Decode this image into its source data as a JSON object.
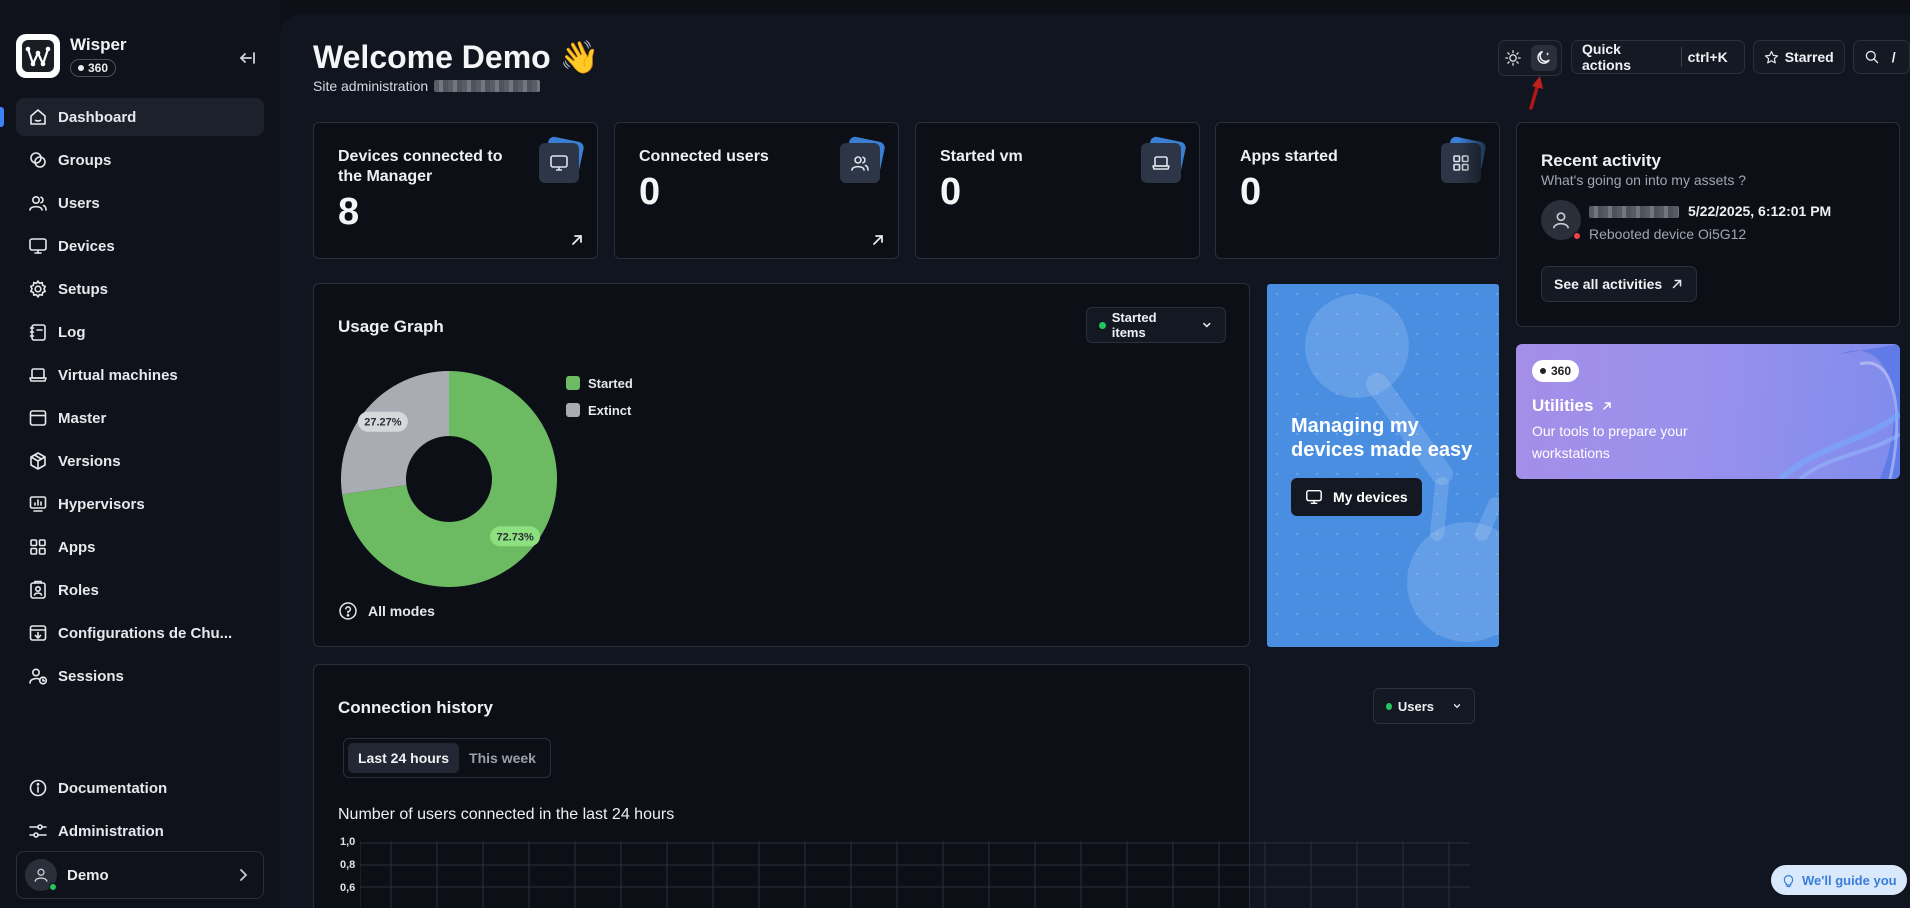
{
  "app": {
    "name": "Wisper",
    "badge": "360"
  },
  "sidebar": {
    "items": [
      {
        "label": "Dashboard",
        "icon": "home-icon"
      },
      {
        "label": "Groups",
        "icon": "groups-icon"
      },
      {
        "label": "Users",
        "icon": "users-icon"
      },
      {
        "label": "Devices",
        "icon": "monitor-icon"
      },
      {
        "label": "Setups",
        "icon": "gear-icon"
      },
      {
        "label": "Log",
        "icon": "log-icon"
      },
      {
        "label": "Virtual machines",
        "icon": "laptop-icon"
      },
      {
        "label": "Master",
        "icon": "window-icon"
      },
      {
        "label": "Versions",
        "icon": "package-icon"
      },
      {
        "label": "Hypervisors",
        "icon": "hypervisor-icon"
      },
      {
        "label": "Apps",
        "icon": "grid-icon"
      },
      {
        "label": "Roles",
        "icon": "roles-icon"
      },
      {
        "label": "Configurations de Chu...",
        "icon": "download-box-icon"
      },
      {
        "label": "Sessions",
        "icon": "user-clock-icon"
      }
    ],
    "bottom": [
      {
        "label": "Documentation",
        "icon": "info-icon"
      },
      {
        "label": "Administration",
        "icon": "sliders-icon"
      }
    ],
    "user": {
      "name": "Demo"
    }
  },
  "header": {
    "title": "Welcome Demo 👋",
    "subtitle": "Site administration",
    "quick_actions": "Quick actions",
    "quick_actions_shortcut": "ctrl+K",
    "starred": "Starred",
    "search_shortcut": "/"
  },
  "stats": [
    {
      "title": "Devices connected to the Manager",
      "value": "8",
      "icon": "monitor-icon"
    },
    {
      "title": "Connected users",
      "value": "0",
      "icon": "users-icon"
    },
    {
      "title": "Started vm",
      "value": "0",
      "icon": "laptop-icon"
    },
    {
      "title": "Apps started",
      "value": "0",
      "icon": "grid-icon"
    }
  ],
  "usage": {
    "title": "Usage Graph",
    "dropdown": "Started items",
    "footer": "All modes"
  },
  "chart_data": {
    "type": "pie",
    "categories": [
      "Started",
      "Extinct"
    ],
    "values": [
      72.73,
      27.27
    ],
    "labels": [
      "72.73%",
      "27.27%"
    ],
    "colors": [
      "#6cba62",
      "#a9acb2"
    ],
    "donut": true,
    "legend": "right"
  },
  "promo": {
    "title": "Managing my devices made easy",
    "button": "My devices"
  },
  "activity": {
    "title": "Recent activity",
    "subtitle": "What's going on into my assets ?",
    "timestamp": "5/22/2025, 6:12:01 PM",
    "action": "Rebooted device Oi5G12",
    "see_all": "See all activities"
  },
  "utilities": {
    "badge": "360",
    "title": "Utilities",
    "description": "Our tools to prepare your workstations"
  },
  "history": {
    "title": "Connection history",
    "dropdown": "Users",
    "tabs": [
      "Last 24 hours",
      "This week"
    ],
    "chart_title": "Number of users connected in the last 24 hours",
    "y_ticks": [
      "1,0",
      "0,8",
      "0,6"
    ]
  },
  "guide": {
    "label": "We'll guide you"
  },
  "colors": {
    "accent": "#3b82f6",
    "started": "#6cba62",
    "extinct": "#a9acb2",
    "promo": "#4a8ee2",
    "status_online": "#22c55e",
    "status_alert": "#ef4444"
  }
}
